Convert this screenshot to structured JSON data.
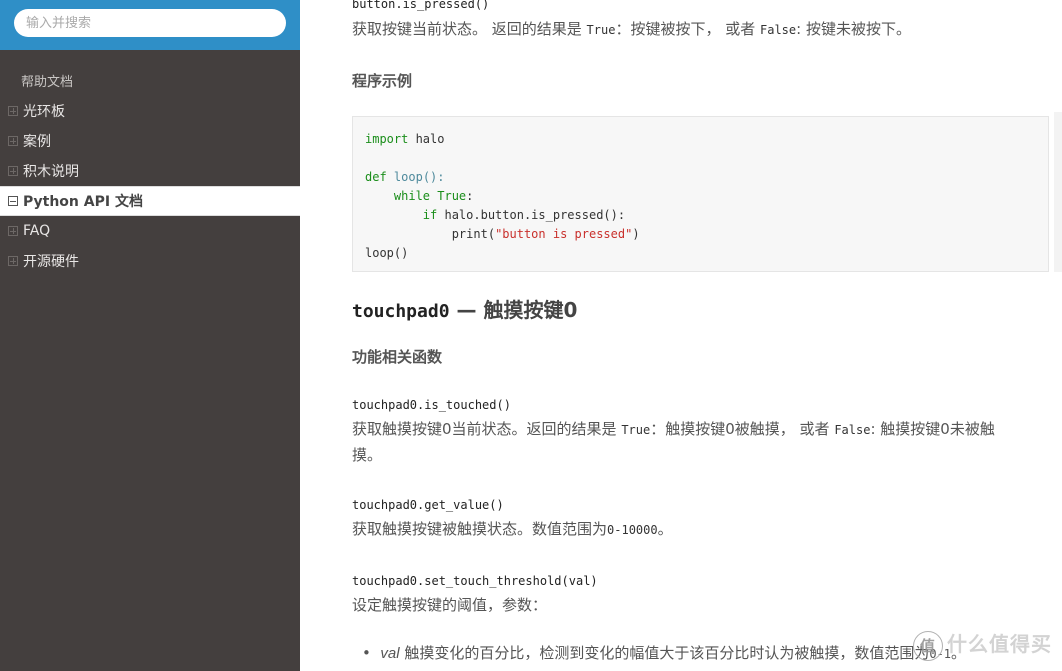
{
  "sidebar": {
    "search_placeholder": "输入并搜索",
    "header": "帮助文档",
    "items": [
      {
        "label": "光环板",
        "state": "collapsed"
      },
      {
        "label": "案例",
        "state": "collapsed"
      },
      {
        "label": "积木说明",
        "state": "collapsed"
      },
      {
        "label": "Python API 文档",
        "state": "expanded",
        "active": true
      },
      {
        "label": "FAQ",
        "state": "collapsed"
      },
      {
        "label": "开源硬件",
        "state": "collapsed"
      }
    ]
  },
  "content": {
    "button_fn": {
      "signature": "button.is_pressed()",
      "desc_prefix": "获取按键当前状态。 返回的结果是 ",
      "true_code": "True",
      "desc_mid": "：按键被按下， 或者 ",
      "false_code": "False",
      "desc_suffix": ": 按键未被按下。"
    },
    "example_heading": "程序示例",
    "code": {
      "l1_kw": "import",
      "l1_rest": " halo",
      "l3_kw": "def",
      "l3_fn": " loop",
      "l3_rest": "():",
      "l4_indent": "    ",
      "l4_kw": "while True",
      "l4_rest": ":",
      "l5_indent": "        ",
      "l5_kw": "if",
      "l5_rest": " halo.button.is_pressed():",
      "l6_indent": "            ",
      "l6_fn": "print(",
      "l6_str": "\"button is pressed\"",
      "l6_end": ")",
      "l7": "loop()"
    },
    "touchpad_heading_code": "touchpad0",
    "touchpad_heading_text": " — 触摸按键0",
    "functions_heading": "功能相关函数",
    "is_touched": {
      "signature": "touchpad0.is_touched()",
      "desc_prefix": "获取触摸按键0当前状态。返回的结果是 ",
      "true_code": "True",
      "desc_mid": "：触摸按键0被触摸， 或者 ",
      "false_code": "False",
      "desc_suffix_line1": ": 触摸按键0未被触",
      "desc_line2": "摸。"
    },
    "get_value": {
      "signature": "touchpad0.get_value()",
      "desc_prefix": "获取触摸按键被触摸状态。数值范围为",
      "range_code": "0-10000",
      "desc_suffix": "。"
    },
    "set_threshold": {
      "signature": "touchpad0.set_touch_threshold(val)",
      "desc": "设定触摸按键的阈值，参数：",
      "param_name": "val",
      "param_desc": " 触摸变化的百分比，检测到变化的幅值大于该百分比时认为被触摸，数值范围为",
      "param_range": "0-1",
      "param_end": "。"
    }
  },
  "watermark": {
    "badge": "值",
    "text": "什么值得买"
  }
}
